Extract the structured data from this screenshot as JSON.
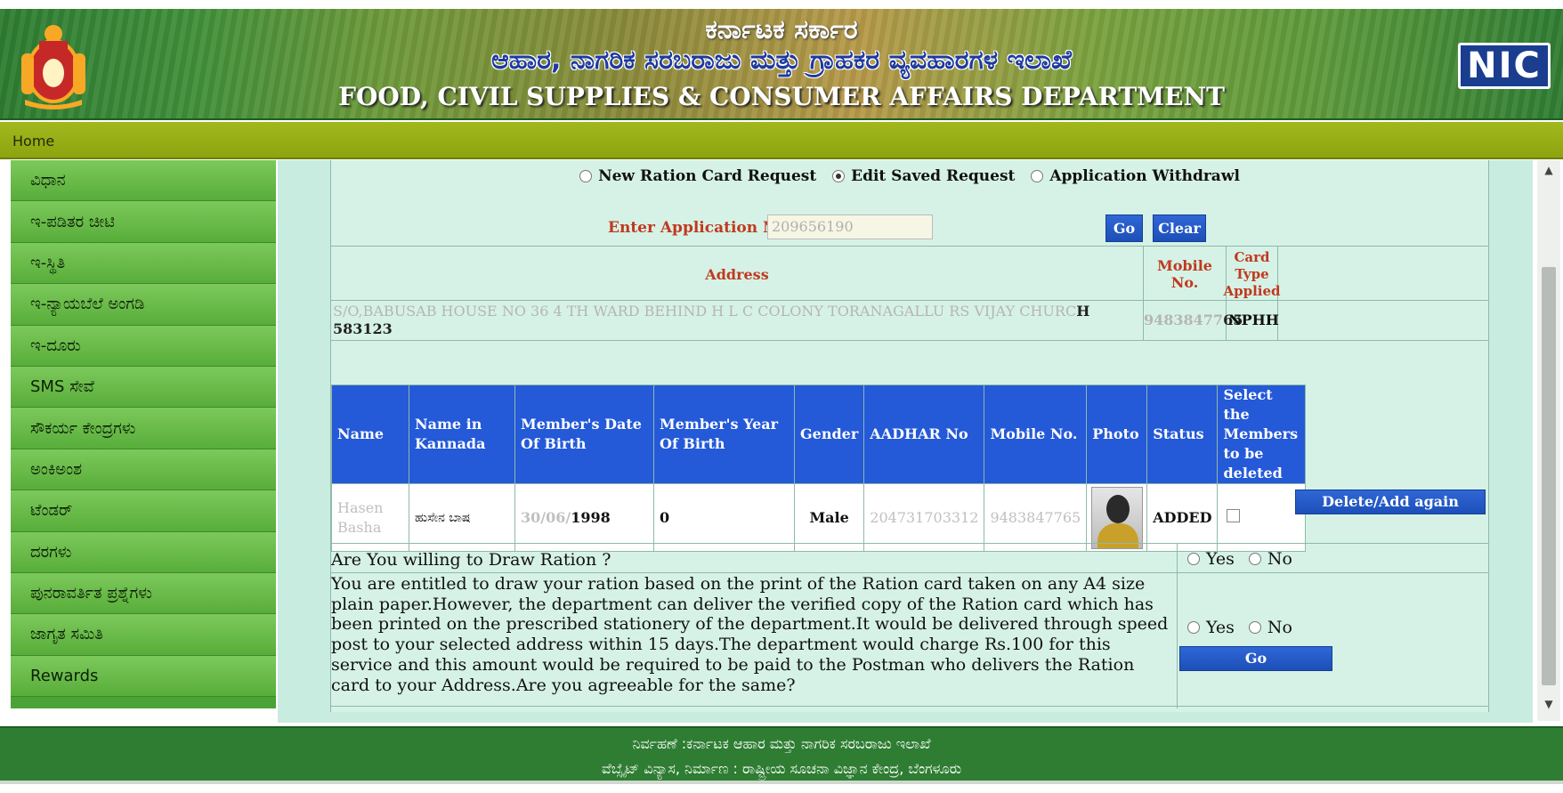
{
  "header": {
    "line1": "ಕರ್ನಾಟಕ ಸರ್ಕಾರ",
    "line2": "ಆಹಾರ, ನಾಗರಿಕ ಸರಬರಾಜು ಮತ್ತು ಗ್ರಾಹಕರ ವ್ಯವಹಾರಗಳ ಇಲಾಖೆ",
    "line3": "FOOD, CIVIL SUPPLIES & CONSUMER AFFAIRS DEPARTMENT",
    "nic": "NIC"
  },
  "nav": {
    "home": "Home"
  },
  "sidebar": {
    "items": [
      {
        "label": "ವಿಧಾನ"
      },
      {
        "label": "ಇ-ಪಡಿತರ ಚೀಟಿ"
      },
      {
        "label": "ಇ-ಸ್ಥಿತಿ"
      },
      {
        "label": "ಇ-ನ್ಯಾಯಬೆಲೆ ಅಂಗಡಿ"
      },
      {
        "label": "ಇ-ದೂರು"
      },
      {
        "label": "SMS ಸೇವೆ"
      },
      {
        "label": "ಸೌಕರ್ಯ ಕೇಂದ್ರಗಳು"
      },
      {
        "label": "ಅಂಕಿಅಂಶ"
      },
      {
        "label": "ಟೆಂಡರ್"
      },
      {
        "label": "ದರಗಳು"
      },
      {
        "label": "ಪುನರಾವರ್ತಿತ ಪ್ರಶ್ನೆಗಳು"
      },
      {
        "label": "ಜಾಗೃತ ಸಮಿತಿ"
      },
      {
        "label": "Rewards"
      }
    ]
  },
  "request_types": {
    "new": "New Ration Card Request",
    "edit": "Edit Saved Request",
    "withdraw": "Application Withdrawl",
    "selected": "edit"
  },
  "application": {
    "label": "Enter Application No.",
    "value": "209656190",
    "go": "Go",
    "clear": "Clear"
  },
  "address_table": {
    "headers": {
      "address": "Address",
      "mobile": "Mobile No.",
      "card_type": "Card Type Applied"
    },
    "address_faded": "S/O,BABUSAB HOUSE NO 36 4 TH WARD BEHIND H L C COLONY TORANAGALLU RS VIJAY CHURC",
    "address_dark_h": "H",
    "address_line2": "583123",
    "mobile_faded": "94838477",
    "mobile_dark": "65",
    "card_type": "NPHH"
  },
  "members": {
    "headers": {
      "name": "Name",
      "name_kannada": "Name in Kannada",
      "dob": "Member's Date Of Birth",
      "yob": "Member's Year Of Birth",
      "gender": "Gender",
      "aadhar": "AADHAR No",
      "mobile": "Mobile No.",
      "photo": "Photo",
      "status": "Status",
      "select": "Select the Members to be deleted"
    },
    "rows": [
      {
        "name": "Hasen Basha",
        "name_kannada": "ಹುಸೇನ ಬಾಷ",
        "dob_faded": "30/06/",
        "dob_dark": "1998",
        "yob": "0",
        "gender": "Male",
        "aadhar": "204731703312",
        "mobile": "9483847765",
        "status": "ADDED"
      }
    ],
    "delete_button": "Delete/Add again"
  },
  "questions": {
    "q1": "Are You willing to Draw Ration ?",
    "q2": "You are entitled to draw your ration based on the print of the Ration card taken on any A4 size plain paper.However, the department can deliver the verified copy of the Ration card which has been printed on the prescribed stationery of the department.It would be delivered through speed post to your selected address within 15 days.The department would charge Rs.100 for this service and this amount would be required to be paid to the Postman who delivers the Ration card to your Address.Are you agreeable for the same?",
    "yes": "Yes",
    "no": "No",
    "go": "Go"
  },
  "footer": {
    "line1": "ನಿರ್ವಹಣೆ :ಕರ್ನಾಟಕ ಆಹಾರ ಮತ್ತು ನಾಗರಿಕ ಸರಬರಾಜು ಇಲಾಖೆ",
    "line2": "ವೆಬ್ಸೈಟ್ ವಿನ್ಯಾಸ, ನಿರ್ಮಾಣ : ರಾಷ್ಟ್ರೀಯ ಸೂಚನಾ ವಿಜ್ಞಾನ ಕೇಂದ್ರ, ಬೆಂಗಳೂರು"
  },
  "colors": {
    "header_green": "#2e7d32",
    "nav_olive": "#a2b81e",
    "sidebar_green": "#58ad3a",
    "panel_mint": "#d6f2e6",
    "table_header_blue": "#2459d8",
    "label_red": "#c0391f"
  }
}
